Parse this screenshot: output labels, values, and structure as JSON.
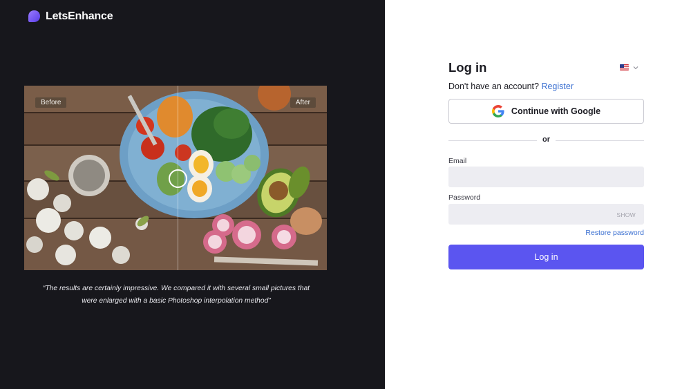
{
  "brand": {
    "name": "LetsEnhance",
    "accent": "#7b5cf5"
  },
  "showcase": {
    "before_label": "Before",
    "after_label": "After",
    "image": "food-bowl-photo",
    "quote_line1": "“The results are certainly impressive. We compared it with several small pictures that",
    "quote_line2": "were enlarged with a basic Photoshop interpolation method”"
  },
  "login": {
    "title": "Log in",
    "language_icon": "us-flag-icon",
    "no_account_text": "Don't have an account?",
    "register_link": "Register",
    "google_button": "Continue with Google",
    "divider_text": "or",
    "email_label": "Email",
    "email_value": "",
    "password_label": "Password",
    "password_value": "",
    "show_toggle": "SHOW",
    "restore_link": "Restore password",
    "submit_button": "Log in",
    "submit_color": "#5b55f0",
    "link_color": "#3a6fd1"
  }
}
